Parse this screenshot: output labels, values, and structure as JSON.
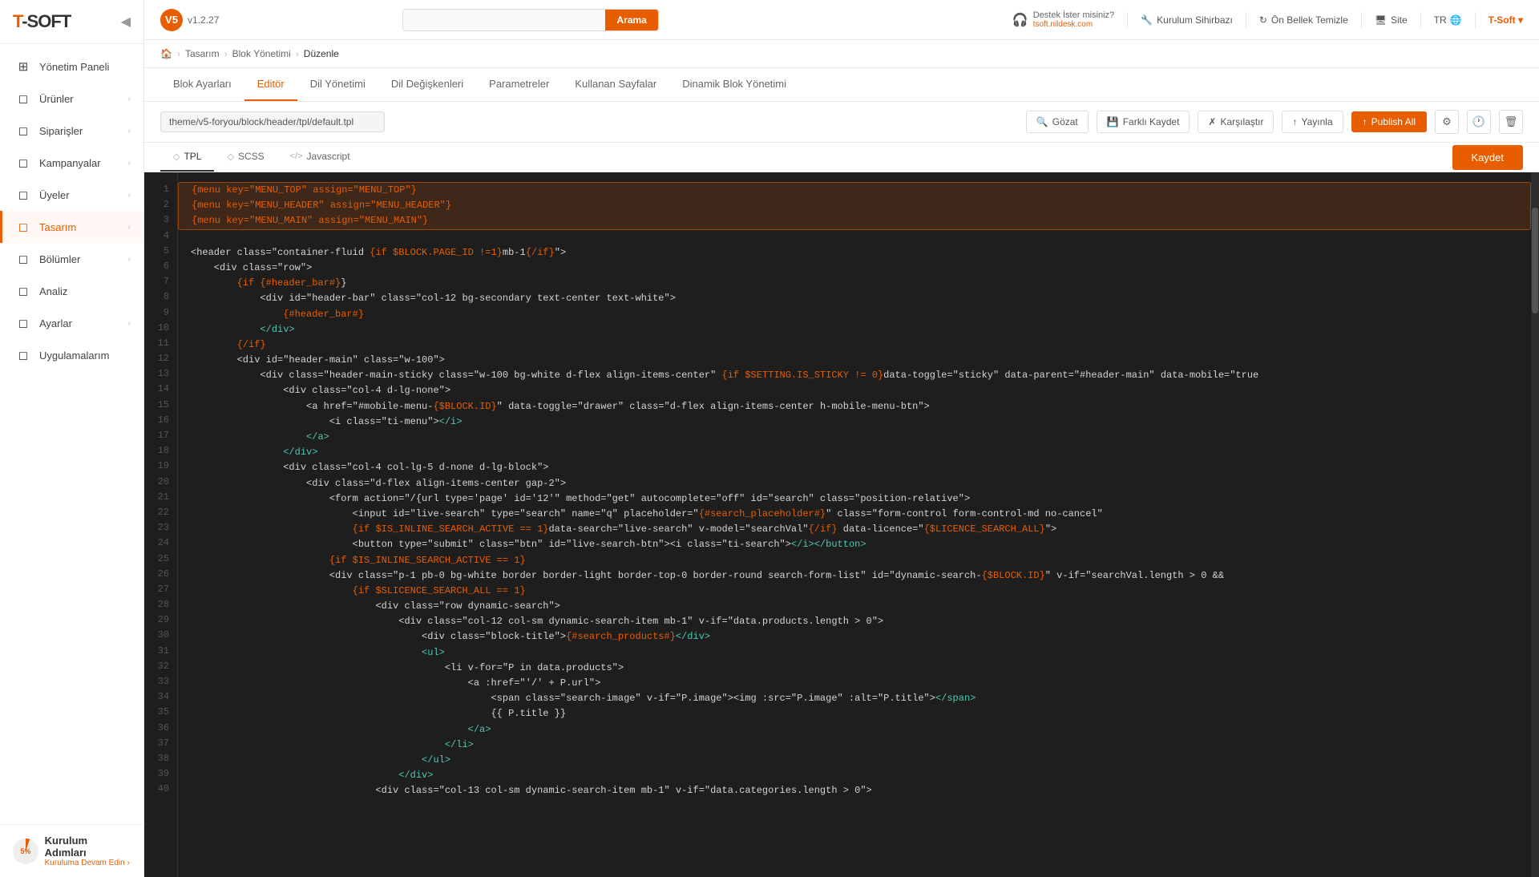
{
  "sidebar": {
    "logo": "T-SOFT",
    "version_label": "v1.2.27",
    "collapse_icon": "◀",
    "items": [
      {
        "id": "yonetim-paneli",
        "label": "Yönetim Paneli",
        "icon": "⊞",
        "has_arrow": false,
        "active": false
      },
      {
        "id": "urunler",
        "label": "Ürünler",
        "icon": "📦",
        "has_arrow": true,
        "active": false
      },
      {
        "id": "siparisler",
        "label": "Siparişler",
        "icon": "🛒",
        "has_arrow": true,
        "active": false
      },
      {
        "id": "kampanyalar",
        "label": "Kampanyalar",
        "icon": "🏷",
        "has_arrow": true,
        "active": false
      },
      {
        "id": "uyeler",
        "label": "Üyeler",
        "icon": "👤",
        "has_arrow": true,
        "active": false
      },
      {
        "id": "tasarim",
        "label": "Tasarım",
        "icon": "🎨",
        "has_arrow": true,
        "active": true
      },
      {
        "id": "bolumler",
        "label": "Bölümler",
        "icon": "⬡",
        "has_arrow": true,
        "active": false
      },
      {
        "id": "analiz",
        "label": "Analiz",
        "icon": "📊",
        "has_arrow": false,
        "active": false
      },
      {
        "id": "ayarlar",
        "label": "Ayarlar",
        "icon": "⚙",
        "has_arrow": true,
        "active": false
      },
      {
        "id": "uygulamalarim",
        "label": "Uygulamalarım",
        "icon": "🔲",
        "has_arrow": false,
        "active": false
      }
    ],
    "setup": {
      "percent": "5%",
      "title": "Kurulum Adımları",
      "subtitle": "Kuruluma Devam Edin ›"
    }
  },
  "topbar": {
    "v5_label": "V5",
    "version": "v1.2.27",
    "search_placeholder": "",
    "search_btn": "Arama",
    "support_label": "Destek İster misiniz?",
    "support_site": "tsoft.nildesk.com",
    "wizard_btn": "Kurulum Sihirbazı",
    "cache_btn": "Ön Bellek Temizle",
    "site_btn": "Site",
    "lang": "TR",
    "user": "T-Soft ▾"
  },
  "breadcrumb": {
    "items": [
      "🏠",
      "Tasarım",
      "Blok Yönetimi",
      "Düzenle"
    ],
    "separators": [
      ">",
      ">",
      ">"
    ]
  },
  "page_tabs": [
    {
      "id": "blok-ayarlari",
      "label": "Blok Ayarları",
      "active": false
    },
    {
      "id": "editor",
      "label": "Editör",
      "active": true
    },
    {
      "id": "dil-yonetimi",
      "label": "Dil Yönetimi",
      "active": false
    },
    {
      "id": "dil-degiskenleri",
      "label": "Dil Değişkenleri",
      "active": false
    },
    {
      "id": "parametreler",
      "label": "Parametreler",
      "active": false
    },
    {
      "id": "kullanan-sayfalar",
      "label": "Kullanan Sayfalar",
      "active": false
    },
    {
      "id": "dinamik-blok",
      "label": "Dinamik Blok Yönetimi",
      "active": false
    }
  ],
  "editor_toolbar": {
    "file_path": "theme/v5-foryou/block/header/tpl/default.tpl",
    "gozat_btn": "Gözat",
    "farkli_kaydet_btn": "Farklı Kaydet",
    "karsilastir_btn": "Karşılaştır",
    "yayinla_btn": "Yayınla",
    "publish_all_btn": "Publish All"
  },
  "editor_tabs": [
    {
      "id": "tpl",
      "label": "TPL",
      "icon": "◇",
      "active": true
    },
    {
      "id": "scss",
      "label": "SCSS",
      "icon": "◇",
      "active": false
    },
    {
      "id": "javascript",
      "label": "Javascript",
      "icon": "<>",
      "active": false
    }
  ],
  "save_btn": "Kaydet",
  "code_lines": [
    {
      "num": 1,
      "text": "{menu key=\"MENU_TOP\" assign=\"MENU_TOP\"}",
      "highlight": "top"
    },
    {
      "num": 2,
      "text": "{menu key=\"MENU_HEADER\" assign=\"MENU_HEADER\"}",
      "highlight": "mid"
    },
    {
      "num": 3,
      "text": "{menu key=\"MENU_MAIN\" assign=\"MENU_MAIN\"}",
      "highlight": "bot"
    },
    {
      "num": 4,
      "text": ""
    },
    {
      "num": 5,
      "text": "<header class=\"container-fluid {if $BLOCK.PAGE_ID !=1}mb-1{/if}\">"
    },
    {
      "num": 6,
      "text": "    <div class=\"row\">"
    },
    {
      "num": 7,
      "text": "        {if {#header_bar#}}"
    },
    {
      "num": 8,
      "text": "            <div id=\"header-bar\" class=\"col-12 bg-secondary text-center text-white\">"
    },
    {
      "num": 9,
      "text": "                {#header_bar#}"
    },
    {
      "num": 10,
      "text": "            </div>"
    },
    {
      "num": 11,
      "text": "        {/if}"
    },
    {
      "num": 12,
      "text": "        <div id=\"header-main\" class=\"w-100\">"
    },
    {
      "num": 13,
      "text": "            <div class=\"header-main-sticky class=\"w-100 bg-white d-flex align-items-center\" {if $SETTING.IS_STICKY != 0}data-toggle=\"sticky\" data-parent=\"#header-main\" data-mobile=\"true"
    },
    {
      "num": 14,
      "text": "                <div class=\"col-4 d-lg-none\">"
    },
    {
      "num": 15,
      "text": "                    <a href=\"#mobile-menu-{$BLOCK.ID}\" data-toggle=\"drawer\" class=\"d-flex align-items-center h-mobile-menu-btn\">"
    },
    {
      "num": 16,
      "text": "                        <i class=\"ti-menu\"></i>"
    },
    {
      "num": 17,
      "text": "                    </a>"
    },
    {
      "num": 18,
      "text": "                </div>"
    },
    {
      "num": 19,
      "text": "                <div class=\"col-4 col-lg-5 d-none d-lg-block\">"
    },
    {
      "num": 20,
      "text": "                    <div class=\"d-flex align-items-center gap-2\">"
    },
    {
      "num": 21,
      "text": "                        <form action=\"/{url type='page' id='12'\" method=\"get\" autocomplete=\"off\" id=\"search\" class=\"position-relative\">"
    },
    {
      "num": 22,
      "text": "                            <input id=\"live-search\" type=\"search\" name=\"q\" placeholder=\"{#search_placeholder#}\" class=\"form-control form-control-md no-cancel\""
    },
    {
      "num": 23,
      "text": "                            {if $IS_INLINE_SEARCH_ACTIVE == 1}data-search=\"live-search\" v-model=\"searchVal\"{/if} data-licence=\"{$LICENCE_SEARCH_ALL}\">"
    },
    {
      "num": 24,
      "text": "                            <button type=\"submit\" class=\"btn\" id=\"live-search-btn\"><i class=\"ti-search\"></i></button>"
    },
    {
      "num": 25,
      "text": "                        {if $IS_INLINE_SEARCH_ACTIVE == 1}"
    },
    {
      "num": 26,
      "text": "                        <div class=\"p-1 pb-0 bg-white border border-light border-top-0 border-round search-form-list\" id=\"dynamic-search-{$BLOCK.ID}\" v-if=\"searchVal.length > 0 &&"
    },
    {
      "num": 27,
      "text": "                            {if $SLICENCE_SEARCH_ALL == 1}"
    },
    {
      "num": 28,
      "text": "                                <div class=\"row dynamic-search\">"
    },
    {
      "num": 29,
      "text": "                                    <div class=\"col-12 col-sm dynamic-search-item mb-1\" v-if=\"data.products.length > 0\">"
    },
    {
      "num": 30,
      "text": "                                        <div class=\"block-title\">{#search_products#}</div>"
    },
    {
      "num": 31,
      "text": "                                        <ul>"
    },
    {
      "num": 32,
      "text": "                                            <li v-for=\"P in data.products\">"
    },
    {
      "num": 33,
      "text": "                                                <a :href=\"'/' + P.url\">"
    },
    {
      "num": 34,
      "text": "                                                    <span class=\"search-image\" v-if=\"P.image\"><img :src=\"P.image\" :alt=\"P.title\"></span>"
    },
    {
      "num": 35,
      "text": "                                                    {{ P.title }}"
    },
    {
      "num": 36,
      "text": "                                                </a>"
    },
    {
      "num": 37,
      "text": "                                            </li>"
    },
    {
      "num": 38,
      "text": "                                        </ul>"
    },
    {
      "num": 39,
      "text": "                                    </div>"
    },
    {
      "num": 40,
      "text": "                                <div class=\"col-13 col-sm dynamic-search-item mb-1\" v-if=\"data.categories.length > 0\">"
    }
  ]
}
